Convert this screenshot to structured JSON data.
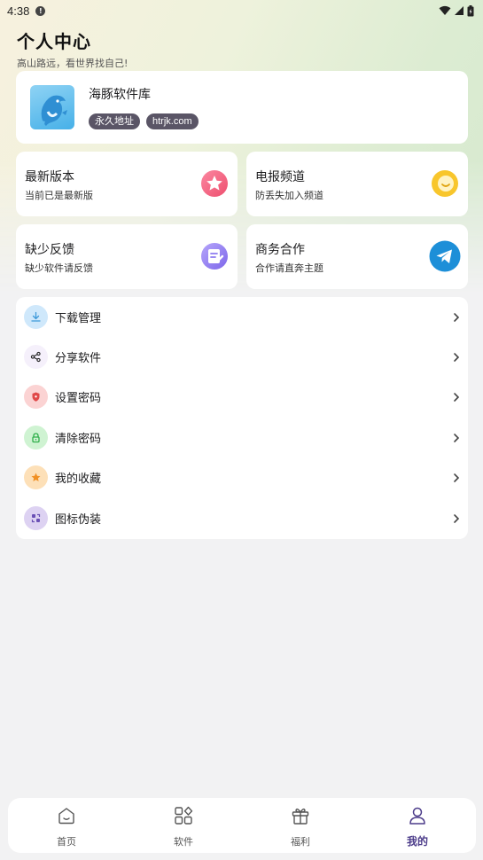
{
  "status_bar": {
    "time": "4:38"
  },
  "header": {
    "title": "个人中心",
    "subtitle": "高山路远，看世界找自己!"
  },
  "profile": {
    "name": "海豚软件库",
    "tags": [
      "永久地址",
      "htrjk.com"
    ]
  },
  "grid": [
    {
      "title": "最新版本",
      "subtitle": "当前已是最新版",
      "icon": "star-icon",
      "color": "#f2607e"
    },
    {
      "title": "电报频道",
      "subtitle": "防丢失加入频道",
      "icon": "chat-bubble-icon",
      "color": "#f6c22b"
    },
    {
      "title": "缺少反馈",
      "subtitle": "缺少软件请反馈",
      "icon": "feedback-note-icon",
      "color": "#8d7bf0"
    },
    {
      "title": "商务合作",
      "subtitle": "合作请直奔主题",
      "icon": "telegram-icon",
      "color": "#1d8fd8"
    }
  ],
  "menu": [
    {
      "label": "下载管理",
      "icon": "download-icon",
      "bg": "#cfe8fb",
      "fg": "#3f9ad9"
    },
    {
      "label": "分享软件",
      "icon": "share-icon",
      "bg": "#f5f0fb",
      "fg": "#222222"
    },
    {
      "label": "设置密码",
      "icon": "shield-icon",
      "bg": "#fbd3d3",
      "fg": "#e04848"
    },
    {
      "label": "清除密码",
      "icon": "lock-icon",
      "bg": "#cff3d2",
      "fg": "#2faf4a"
    },
    {
      "label": "我的收藏",
      "icon": "star-icon",
      "bg": "#fde0b8",
      "fg": "#f09024"
    },
    {
      "label": "图标伪装",
      "icon": "swap-icon",
      "bg": "#ddd2f2",
      "fg": "#6a50b5"
    }
  ],
  "bottom_nav": [
    {
      "label": "首页",
      "icon": "home-icon",
      "active": false
    },
    {
      "label": "软件",
      "icon": "apps-icon",
      "active": false
    },
    {
      "label": "福利",
      "icon": "gift-icon",
      "active": false
    },
    {
      "label": "我的",
      "icon": "user-icon",
      "active": true
    }
  ],
  "colors": {
    "accent": "#4c3c8a",
    "tag_bg": "#5a5566"
  }
}
